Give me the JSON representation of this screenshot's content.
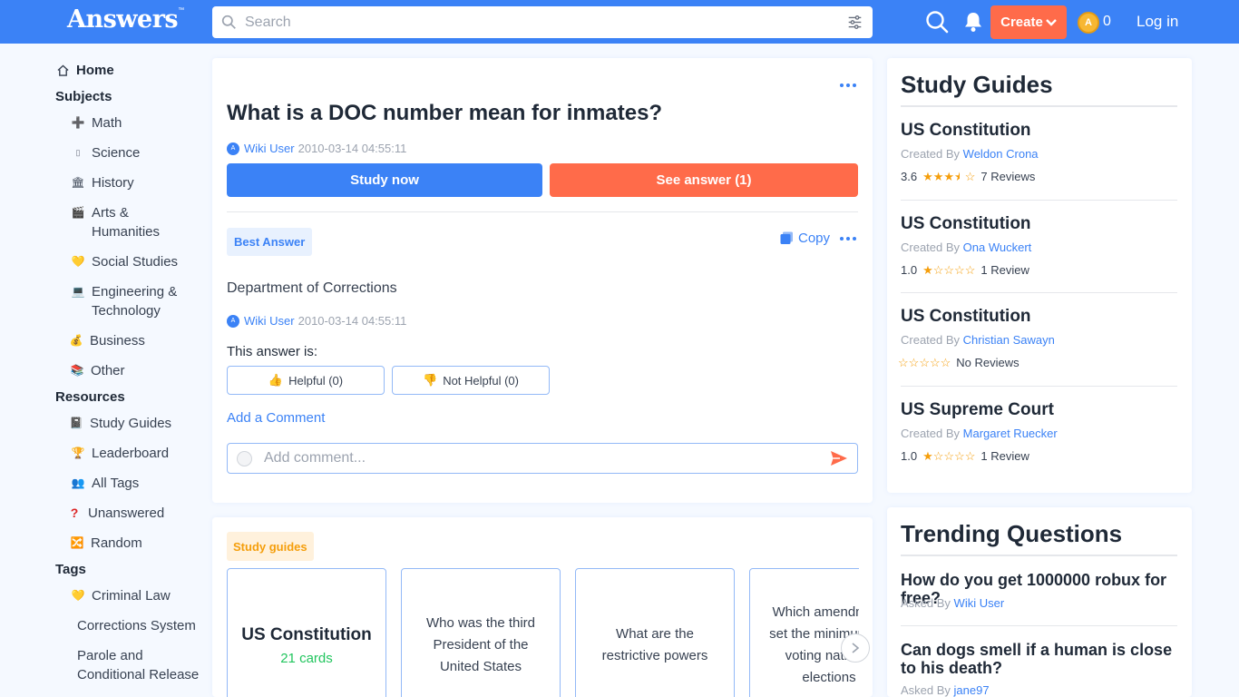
{
  "header": {
    "logo": "Answers",
    "logo_tm": "™",
    "search_placeholder": "Search",
    "create_label": "Create",
    "coins": "0",
    "login_label": "Log in"
  },
  "sidebar": {
    "home": "Home",
    "subjects_heading": "Subjects",
    "subjects": [
      {
        "label": "Math",
        "icon": "math-icon"
      },
      {
        "label": "Science",
        "icon": "science-icon"
      },
      {
        "label": "History",
        "icon": "history-icon"
      },
      {
        "label": "Arts & Humanities",
        "icon": "arts-icon"
      },
      {
        "label": "Social Studies",
        "icon": "social-studies-icon"
      },
      {
        "label": "Engineering & Technology",
        "icon": "laptop-icon"
      },
      {
        "label": "Business",
        "icon": "money-bag-icon"
      },
      {
        "label": "Other",
        "icon": "books-icon"
      }
    ],
    "resources_heading": "Resources",
    "resources": [
      {
        "label": "Study Guides",
        "icon": "notebook-icon"
      },
      {
        "label": "Leaderboard",
        "icon": "trophy-icon"
      },
      {
        "label": "All Tags",
        "icon": "tags-icon"
      },
      {
        "label": "Unanswered",
        "icon": "question-icon"
      },
      {
        "label": "Random",
        "icon": "shuffle-icon"
      }
    ],
    "tags_heading": "Tags",
    "tags": [
      {
        "label": "Criminal Law",
        "icon": "social-studies-icon"
      },
      {
        "label": "Corrections System"
      },
      {
        "label": "Parole and Conditional Release"
      }
    ]
  },
  "question": {
    "title": "What is a DOC number mean for inmates?",
    "author": "Wiki User",
    "date": "2010-03-14 04:55:11",
    "study_now": "Study now",
    "see_answer": "See answer (1)"
  },
  "answer": {
    "badge": "Best Answer",
    "copy": "Copy",
    "text": "Department of Corrections",
    "author": "Wiki User",
    "date": "2010-03-14 04:55:11",
    "helpful_label": "This answer is:",
    "helpful": "Helpful (0)",
    "not_helpful": "Not Helpful (0)",
    "add_comment": "Add a Comment",
    "comment_placeholder": "Add comment..."
  },
  "study_strip": {
    "badge": "Study guides",
    "items": [
      {
        "title": "US Constitution",
        "cards": "21 cards"
      },
      {
        "title": "Who was the third President of the United States"
      },
      {
        "title": "What are the restrictive powers"
      },
      {
        "title": "Which amendment set the minimum for voting national elections"
      }
    ]
  },
  "study_guides": {
    "title": "Study Guides",
    "created_by_label": "Created By",
    "items": [
      {
        "title": "US Constitution",
        "author": "Weldon Crona",
        "rating": "3.6",
        "stars": 3.5,
        "reviews": "7 Reviews"
      },
      {
        "title": "US Constitution",
        "author": "Ona Wuckert",
        "rating": "1.0",
        "stars": 1,
        "reviews": "1 Review"
      },
      {
        "title": "US Constitution",
        "author": "Christian Sawayn",
        "rating": "",
        "stars": 0,
        "reviews": "No Reviews"
      },
      {
        "title": "US Supreme Court",
        "author": "Margaret Ruecker",
        "rating": "1.0",
        "stars": 1,
        "reviews": "1 Review"
      }
    ]
  },
  "trending": {
    "title": "Trending Questions",
    "asked_by_label": "Asked By",
    "items": [
      {
        "question": "How do you get 1000000 robux for free?",
        "author": "Wiki User"
      },
      {
        "question": "Can dogs smell if a human is close to his death?",
        "author": "jane97"
      }
    ]
  },
  "colors": {
    "brand_blue": "#3b82f6",
    "accent_orange": "#ff6b4a",
    "star": "#f59e0b",
    "cards_green": "#22c55e"
  }
}
